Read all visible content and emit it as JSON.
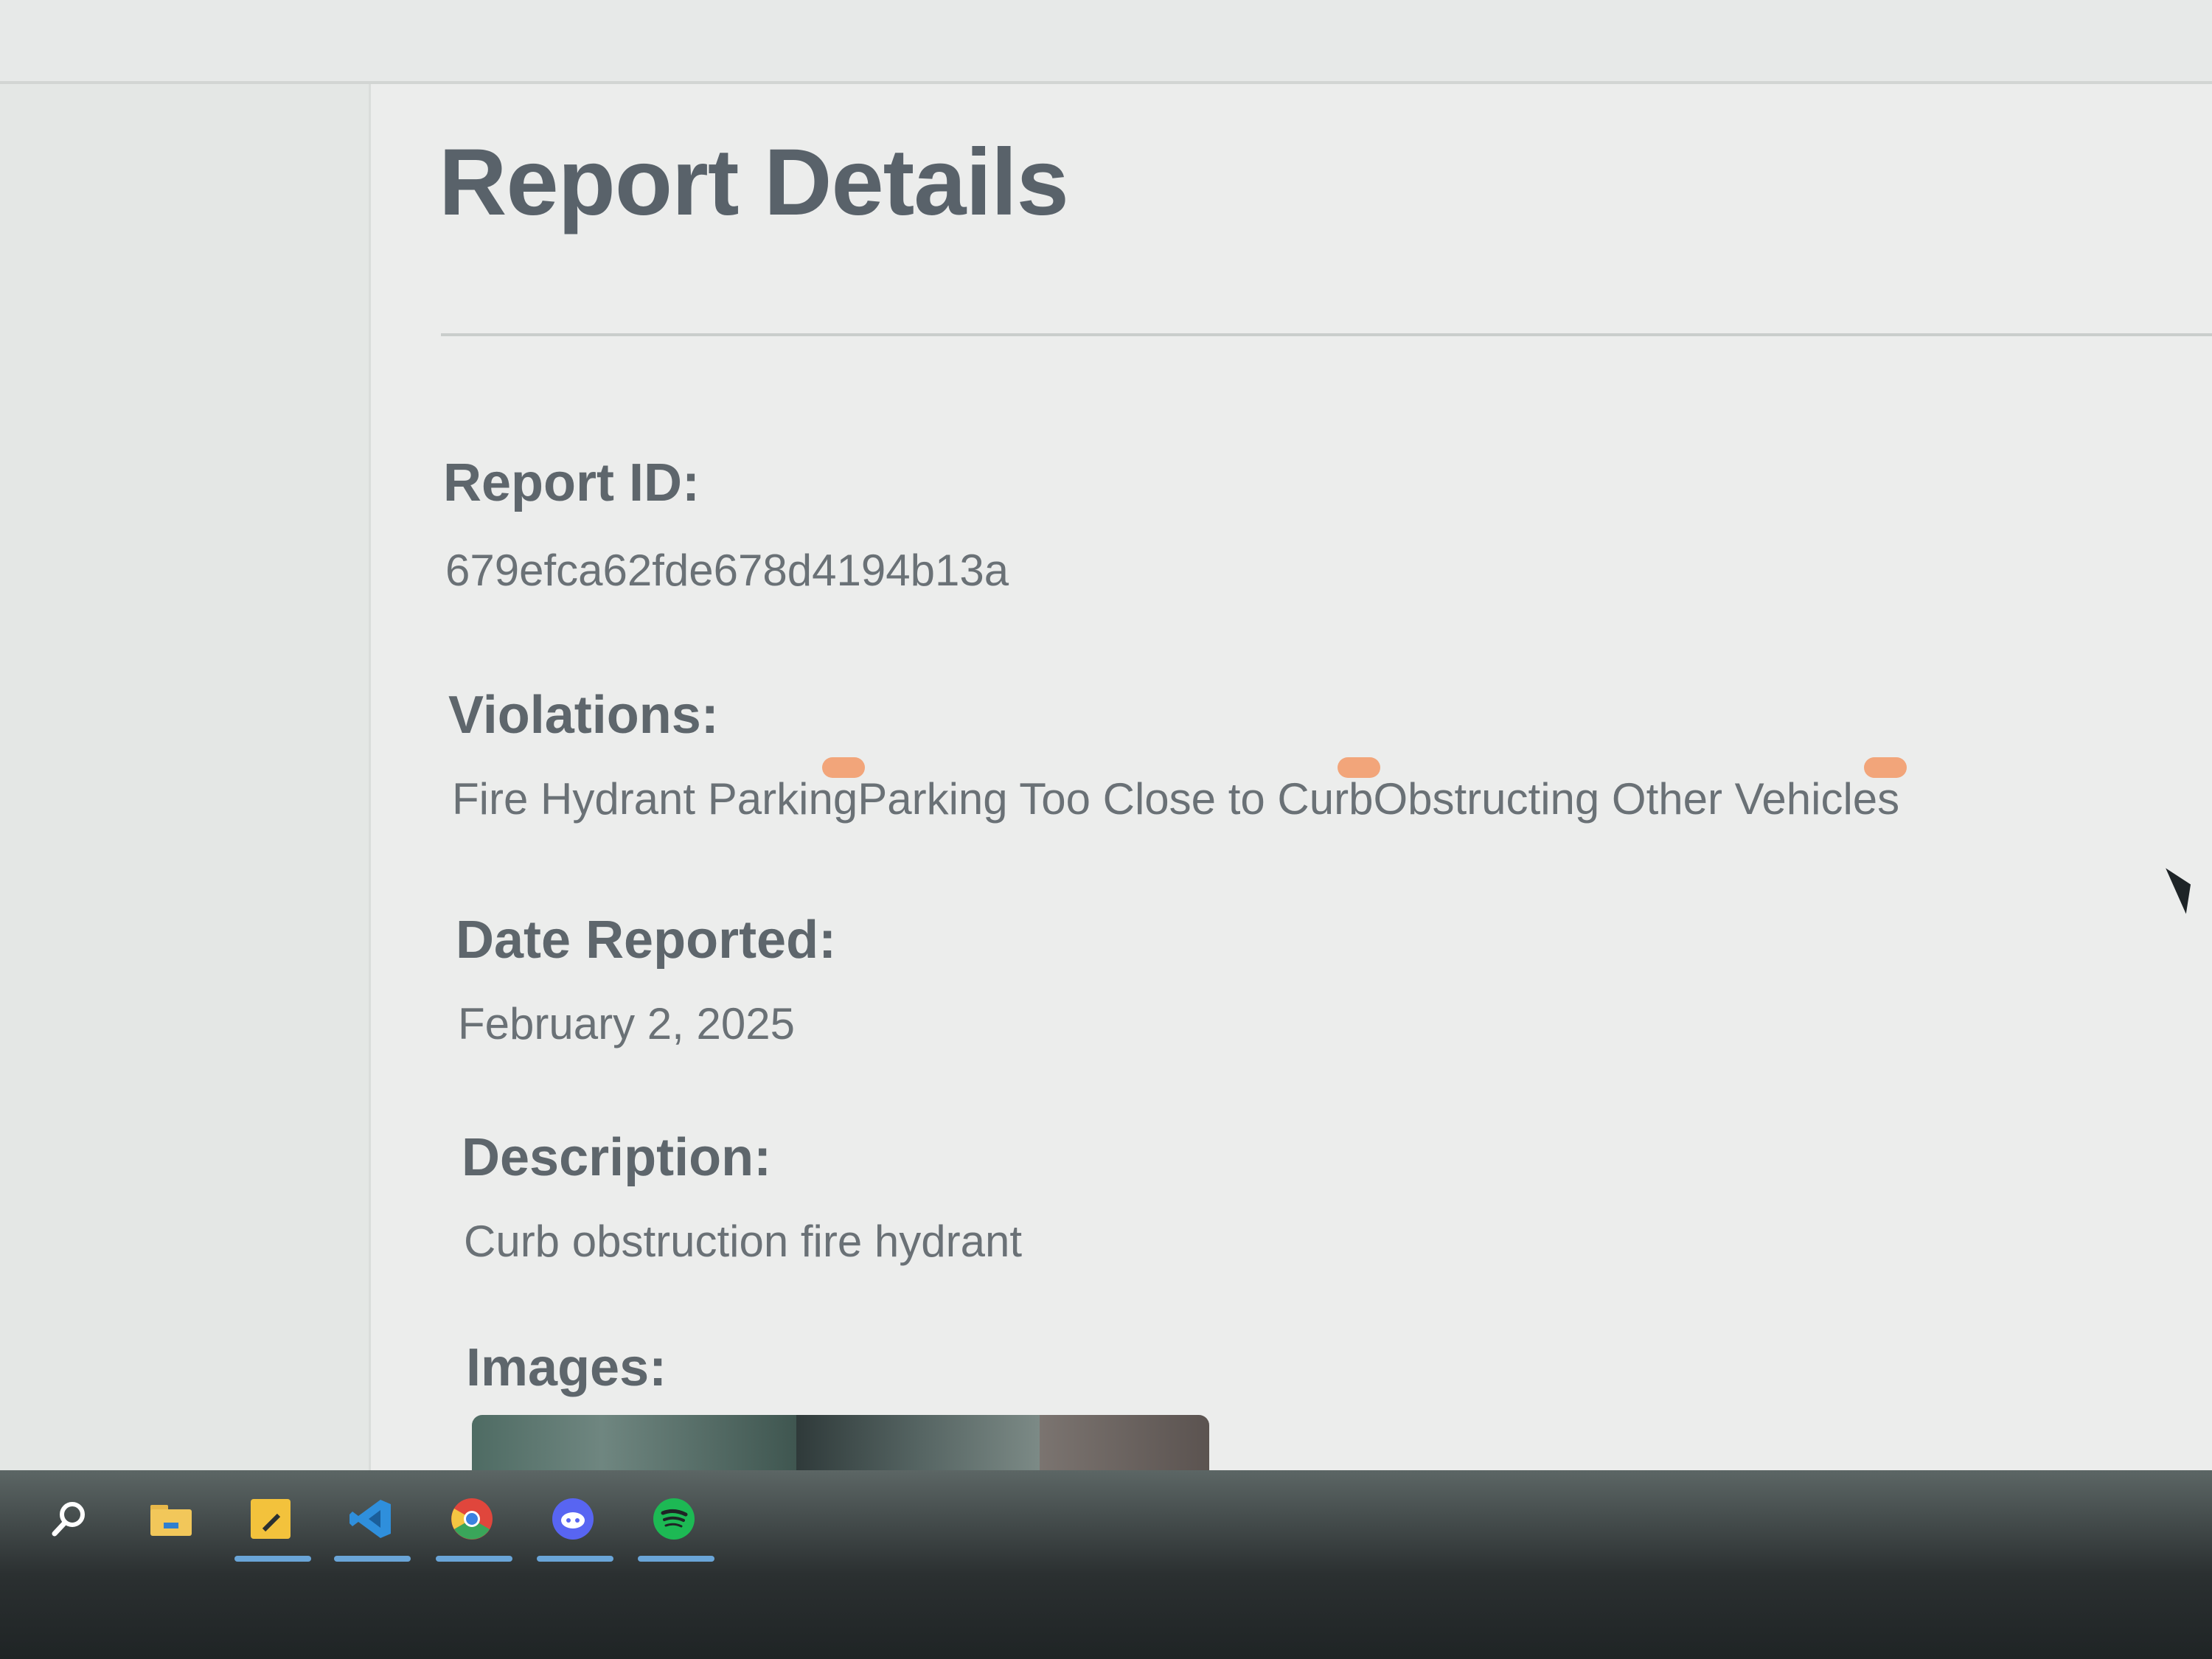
{
  "page": {
    "title": "Report Details"
  },
  "report": {
    "id_label": "Report ID:",
    "id_value": "679efca62fde678d4194b13a",
    "violations_label": "Violations:",
    "violations": [
      "Fire Hydrant Parking",
      "Parking Too Close to Curb",
      "Obstructing Other Vehicles"
    ],
    "date_label": "Date Reported:",
    "date_value": "February 2, 2025",
    "description_label": "Description:",
    "description_value": "Curb obstruction fire hydrant",
    "images_label": "Images:"
  },
  "taskbar": {
    "items": [
      {
        "icon": "search-icon",
        "color": "#ffffff"
      },
      {
        "icon": "file-explorer-icon",
        "color": "#e8b84a"
      },
      {
        "icon": "sticky-notes-icon",
        "color": "#f3c23c"
      },
      {
        "icon": "vscode-icon",
        "color": "#2f8fdc"
      },
      {
        "icon": "chrome-icon",
        "color": "#e0463c"
      },
      {
        "icon": "discord-icon",
        "color": "#5865f2"
      },
      {
        "icon": "spotify-icon",
        "color": "#1db954"
      }
    ]
  },
  "colors": {
    "violation_tag": "#f2a57a",
    "heading": "#59626a",
    "text": "#6a7176"
  }
}
